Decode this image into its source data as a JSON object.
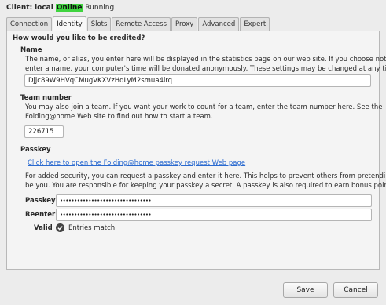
{
  "status": {
    "label": "Client:",
    "host": "local",
    "online": "Online",
    "state": "Running"
  },
  "tabs": [
    "Connection",
    "Identity",
    "Slots",
    "Remote Access",
    "Proxy",
    "Advanced",
    "Expert"
  ],
  "active_tab": "Identity",
  "identity": {
    "heading": "How would you like to be credited?",
    "name": {
      "label": "Name",
      "desc1": "The name, or alias, you enter here will be displayed in the statistics page on our web site.  If you choose not to",
      "desc2": "enter a name, your computer's time will be donated anonymously.  These settings may be changed at any time.",
      "value": "Djjc89W9HVqCMugVKXVzHdLyM2smua4irq"
    },
    "team": {
      "label": "Team number",
      "desc1": "You may also join a team.  If you want your work to count for a team, enter the team number here.  See the",
      "desc2": "Folding@home Web site to find out how to start a team.",
      "value": "226715"
    },
    "passkey": {
      "label": "Passkey",
      "link": "Click here to open the Folding@home passkey request Web page",
      "desc1": "For added security, you can request a passkey and enter it here.  This helps to prevent others from pretending to",
      "desc2": "be you.  You are responsible for keeping your passkey a secret.  A passkey is also required to earn bonus points.",
      "passkey_label": "Passkey",
      "passkey_value": "••••••••••••••••••••••••••••••••",
      "reenter_label": "Reenter",
      "reenter_value": "••••••••••••••••••••••••••••••••",
      "valid_label": "Valid",
      "valid_text": "Entries match"
    }
  },
  "buttons": {
    "save": "Save",
    "cancel": "Cancel"
  },
  "colors": {
    "online_badge": "#3fd43f",
    "link": "#2a6ad0"
  }
}
